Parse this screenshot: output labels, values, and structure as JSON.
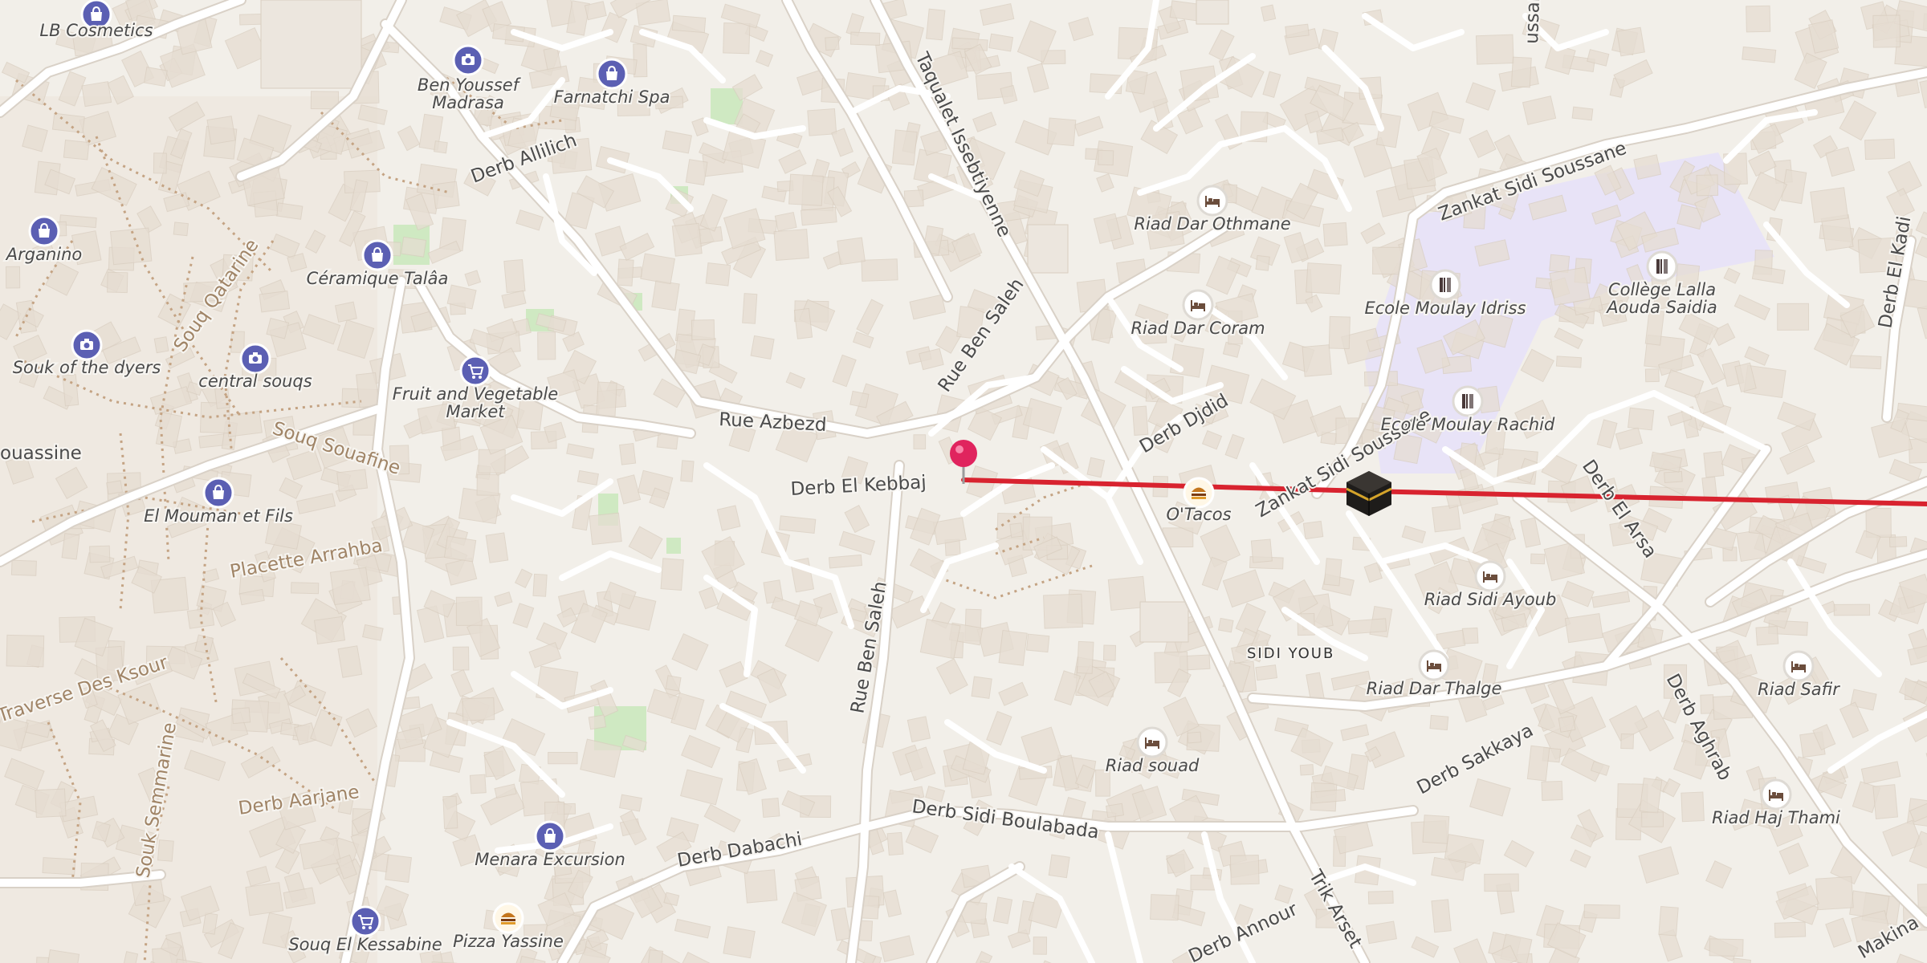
{
  "colors": {
    "land": "#f2efe9",
    "building": "#e6ddd2",
    "building_stroke": "#d9cec0",
    "road": "#ffffff",
    "road_casing": "#dcd4ca",
    "path": "#c4a383",
    "park": "#cfe9c2",
    "school_area": "#e8e3f7",
    "route": "#d8232f",
    "pin": "#e0245e",
    "poi_shop": "#5b5fb3",
    "poi_lodging": "#7a5c4a"
  },
  "pois": [
    {
      "label": "LB Cosmetics",
      "icon": "shopping-bag-icon",
      "kind": "shop"
    },
    {
      "label": "Ben Youssef Madrasa",
      "icon": "camera-icon",
      "kind": "attraction"
    },
    {
      "label": "Farnatchi Spa",
      "icon": "shopping-bag-icon",
      "kind": "shop"
    },
    {
      "label": "Arganino",
      "icon": "shopping-bag-icon",
      "kind": "shop"
    },
    {
      "label": "Céramique Talâa",
      "icon": "shopping-bag-icon",
      "kind": "shop"
    },
    {
      "label": "Souk of the dyers",
      "icon": "camera-icon",
      "kind": "attraction"
    },
    {
      "label": "central souqs",
      "icon": "camera-icon",
      "kind": "attraction"
    },
    {
      "label": "Fruit and Vegetable Market",
      "icon": "shopping-cart-icon",
      "kind": "shop"
    },
    {
      "label": "El Mouman et Fils",
      "icon": "shopping-bag-icon",
      "kind": "shop"
    },
    {
      "label": "Menara Excursion",
      "icon": "shopping-bag-icon",
      "kind": "shop"
    },
    {
      "label": "Souq El Kessabine",
      "icon": "shopping-cart-icon",
      "kind": "shop"
    },
    {
      "label": "Pizza Yassine",
      "icon": "fast-food-icon",
      "kind": "food"
    },
    {
      "label": "O'Tacos",
      "icon": "fast-food-icon",
      "kind": "food"
    },
    {
      "label": "Riad Dar Othmane",
      "icon": "bed-icon",
      "kind": "lodging"
    },
    {
      "label": "Riad Dar Coram",
      "icon": "bed-icon",
      "kind": "lodging"
    },
    {
      "label": "Riad Sidi Ayoub",
      "icon": "bed-icon",
      "kind": "lodging"
    },
    {
      "label": "Riad Dar Thalge",
      "icon": "bed-icon",
      "kind": "lodging"
    },
    {
      "label": "Riad souad",
      "icon": "bed-icon",
      "kind": "lodging"
    },
    {
      "label": "Riad Safir",
      "icon": "bed-icon",
      "kind": "lodging"
    },
    {
      "label": "Riad Haj Thami",
      "icon": "bed-icon",
      "kind": "lodging"
    },
    {
      "label": "Ecole Moulay Idriss",
      "icon": "school-icon",
      "kind": "school"
    },
    {
      "label": "Collège Lalla Aouda Saidia",
      "icon": "school-icon",
      "kind": "school"
    },
    {
      "label": "Ecole Moulay Rachid",
      "icon": "school-icon",
      "kind": "school"
    }
  ],
  "streets": [
    "Derb Allilich",
    "Taqualet Issebtiyenne",
    "Rue Ben Saleh",
    "Rue Azbezd",
    "Derb El Kebbaj",
    "Derb Djdid",
    "Zankat Sidi Soussane",
    "Zankat Sidi Soussane",
    "Derb El Arsa",
    "Derb El Kadi",
    "Derb Aghrab",
    "Derb Sakkaya",
    "Derb Sidi Boulabada",
    "Derb Dabachi",
    "Derb Annour",
    "Trik Arset",
    "Souq Qatarine",
    "Souq Souafine",
    "Placette Arrahba",
    "Traverse Des Ksour",
    "Souk Semmarine",
    "Derb Aarjane",
    "Rue Ben Saleh",
    "ouassine",
    "ussan",
    "Makina"
  ],
  "districts": [
    "SIDI YOUB"
  ],
  "markers": {
    "pin": {
      "name": "dropped-pin"
    },
    "destination": {
      "name": "kaaba-qibla-marker"
    }
  }
}
